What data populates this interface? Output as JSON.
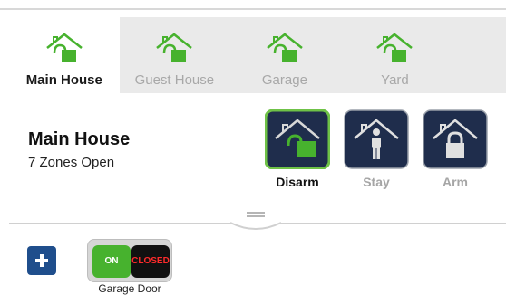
{
  "tabs": [
    {
      "label": "Main House",
      "active": true,
      "icon": "house-icon"
    },
    {
      "label": "Guest House",
      "active": false,
      "icon": "house-icon"
    },
    {
      "label": "Garage",
      "active": false,
      "icon": "house-icon"
    },
    {
      "label": "Yard",
      "active": false,
      "icon": "house-icon"
    }
  ],
  "panel": {
    "title": "Main House",
    "status": "7 Zones Open"
  },
  "modes": [
    {
      "label": "Disarm",
      "icon": "house-unlocked-icon",
      "active": true
    },
    {
      "label": "Stay",
      "icon": "house-person-icon",
      "active": false
    },
    {
      "label": "Arm",
      "icon": "house-locked-icon",
      "active": false
    }
  ],
  "device": {
    "name": "Garage Door",
    "on_label": "ON",
    "state_label": "CLOSED"
  },
  "colors": {
    "accent_green": "#47b22e",
    "mode_dark": "#1f2d4c",
    "add_button": "#1f4e8c",
    "closed_red": "#ff2b2b"
  }
}
